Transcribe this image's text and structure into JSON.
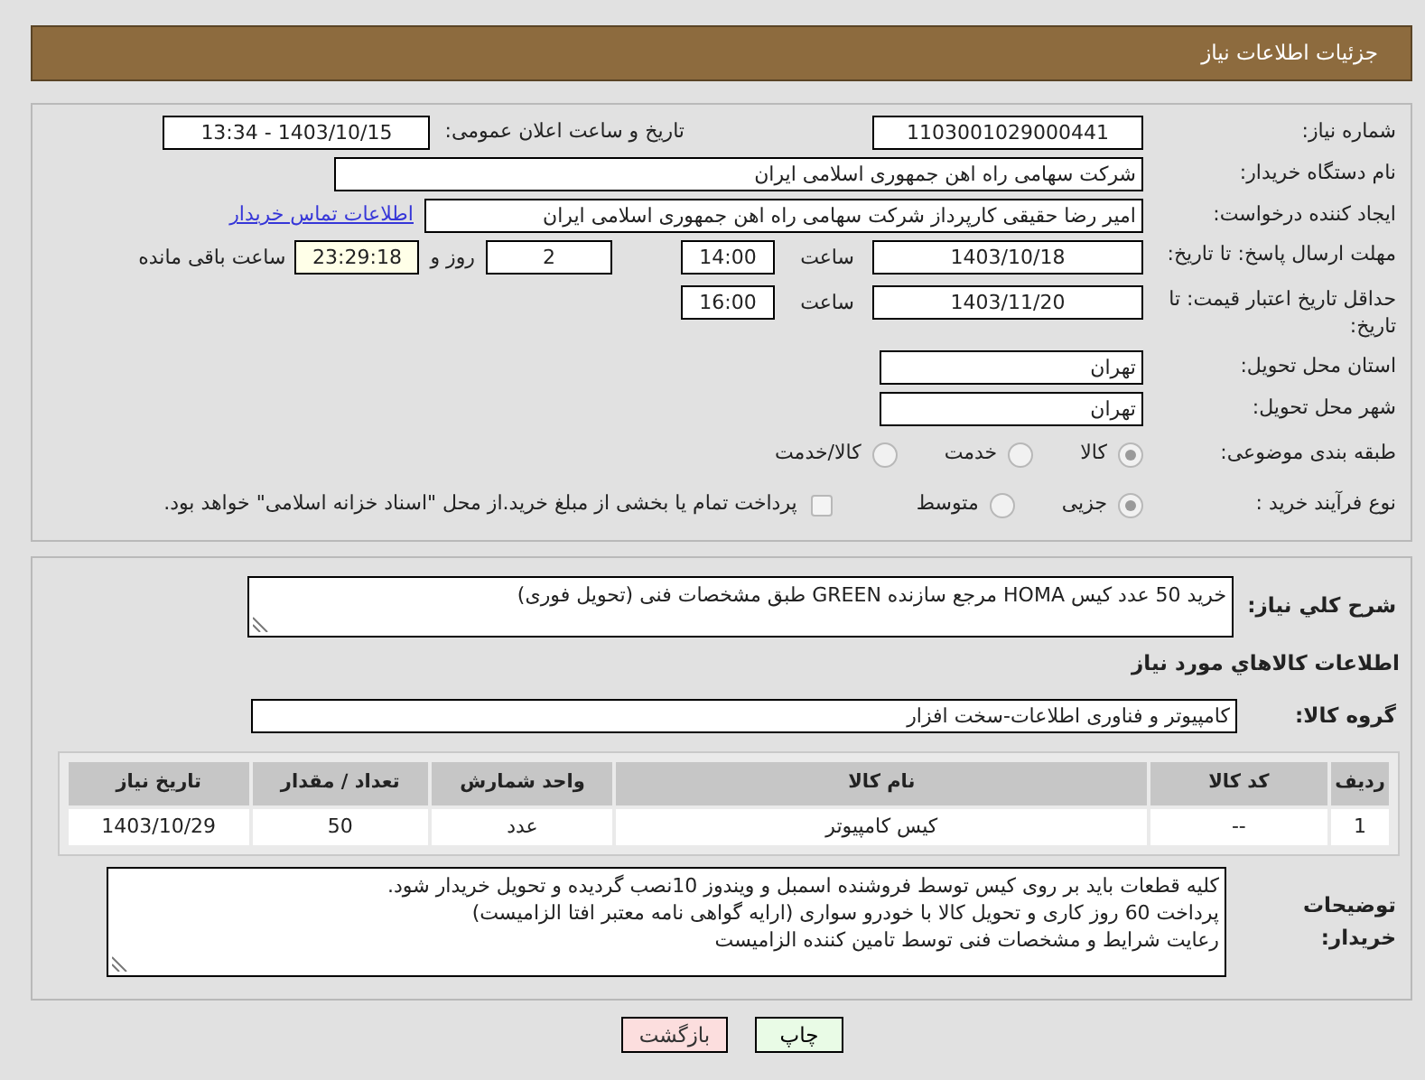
{
  "page_title": "جزئیات اطلاعات نیاز",
  "need_number": {
    "label": "شماره نیاز:",
    "value": "1103001029000441"
  },
  "announcement": {
    "label": "تاریخ و ساعت اعلان عمومی:",
    "value": "1403/10/15 - 13:34"
  },
  "buyer_org": {
    "label": "نام دستگاه خریدار:",
    "value": "شرکت سهامی راه اهن جمهوری اسلامی ایران"
  },
  "requester": {
    "label": "ایجاد کننده درخواست:",
    "value": "امیر رضا  حقیقی کارپرداز شرکت سهامی راه اهن جمهوری اسلامی ایران",
    "link": "اطلاعات تماس خریدار"
  },
  "reply_deadline": {
    "label": "مهلت ارسال پاسخ: تا تاریخ:",
    "date": "1403/10/18",
    "time_label": "ساعت",
    "time": "14:00",
    "days": "2",
    "days_label": "روز و",
    "remaining": "23:29:18",
    "remaining_label": "ساعت باقی مانده"
  },
  "price_validity": {
    "label": "حداقل تاریخ اعتبار قیمت: تا تاریخ:",
    "date": "1403/11/20",
    "time_label": "ساعت",
    "time": "16:00"
  },
  "province": {
    "label": "استان محل تحویل:",
    "value": "تهران"
  },
  "city": {
    "label": "شهر محل تحویل:",
    "value": "تهران"
  },
  "category": {
    "label": "طبقه بندی موضوعی:",
    "options": [
      {
        "label": "کالا",
        "selected": true
      },
      {
        "label": "خدمت",
        "selected": false
      },
      {
        "label": "کالا/خدمت",
        "selected": false
      }
    ]
  },
  "process": {
    "label": "نوع فرآیند خرید :",
    "options": [
      {
        "label": "جزیی",
        "selected": true
      },
      {
        "label": "متوسط",
        "selected": false
      }
    ],
    "treasury": {
      "label": "پرداخت تمام یا بخشی از مبلغ خرید.از محل \"اسناد خزانه اسلامی\" خواهد بود.",
      "checked": false
    }
  },
  "description": {
    "label": "شرح كلي نياز:",
    "value": "خرید 50 عدد کیس HOMA مرجع سازنده GREEN طبق مشخصات فنی (تحویل فوری)"
  },
  "goods_heading": "اطلاعات كالاهاي مورد نياز",
  "goods_group": {
    "label": "گروه کالا:",
    "value": "کامپیوتر و فناوری اطلاعات-سخت افزار"
  },
  "table": {
    "columns": [
      "ردیف",
      "کد کالا",
      "نام کالا",
      "واحد شمارش",
      "تعداد / مقدار",
      "تاریخ نیاز"
    ],
    "rows": [
      [
        "1",
        "--",
        "کیس کامپیوتر",
        "عدد",
        "50",
        "1403/10/29"
      ]
    ]
  },
  "buyer_notes": {
    "label": "توضیحات خریدار:",
    "lines": [
      "کلیه قطعات باید بر روی کیس توسط فروشنده اسمبل و ویندوز 10نصب گردیده و تحویل خریدار شود.",
      "پرداخت 60 روز کاری و تحویل کالا با خودرو سواری (ارایه گواهی نامه معتبر افتا الزامیست)",
      "رعایت شرایط و مشخصات فنی توسط تامین کننده الزامیست"
    ]
  },
  "buttons": [
    {
      "label": "چاپ",
      "kind": "print"
    },
    {
      "label": "بازگشت",
      "kind": "back"
    }
  ]
}
